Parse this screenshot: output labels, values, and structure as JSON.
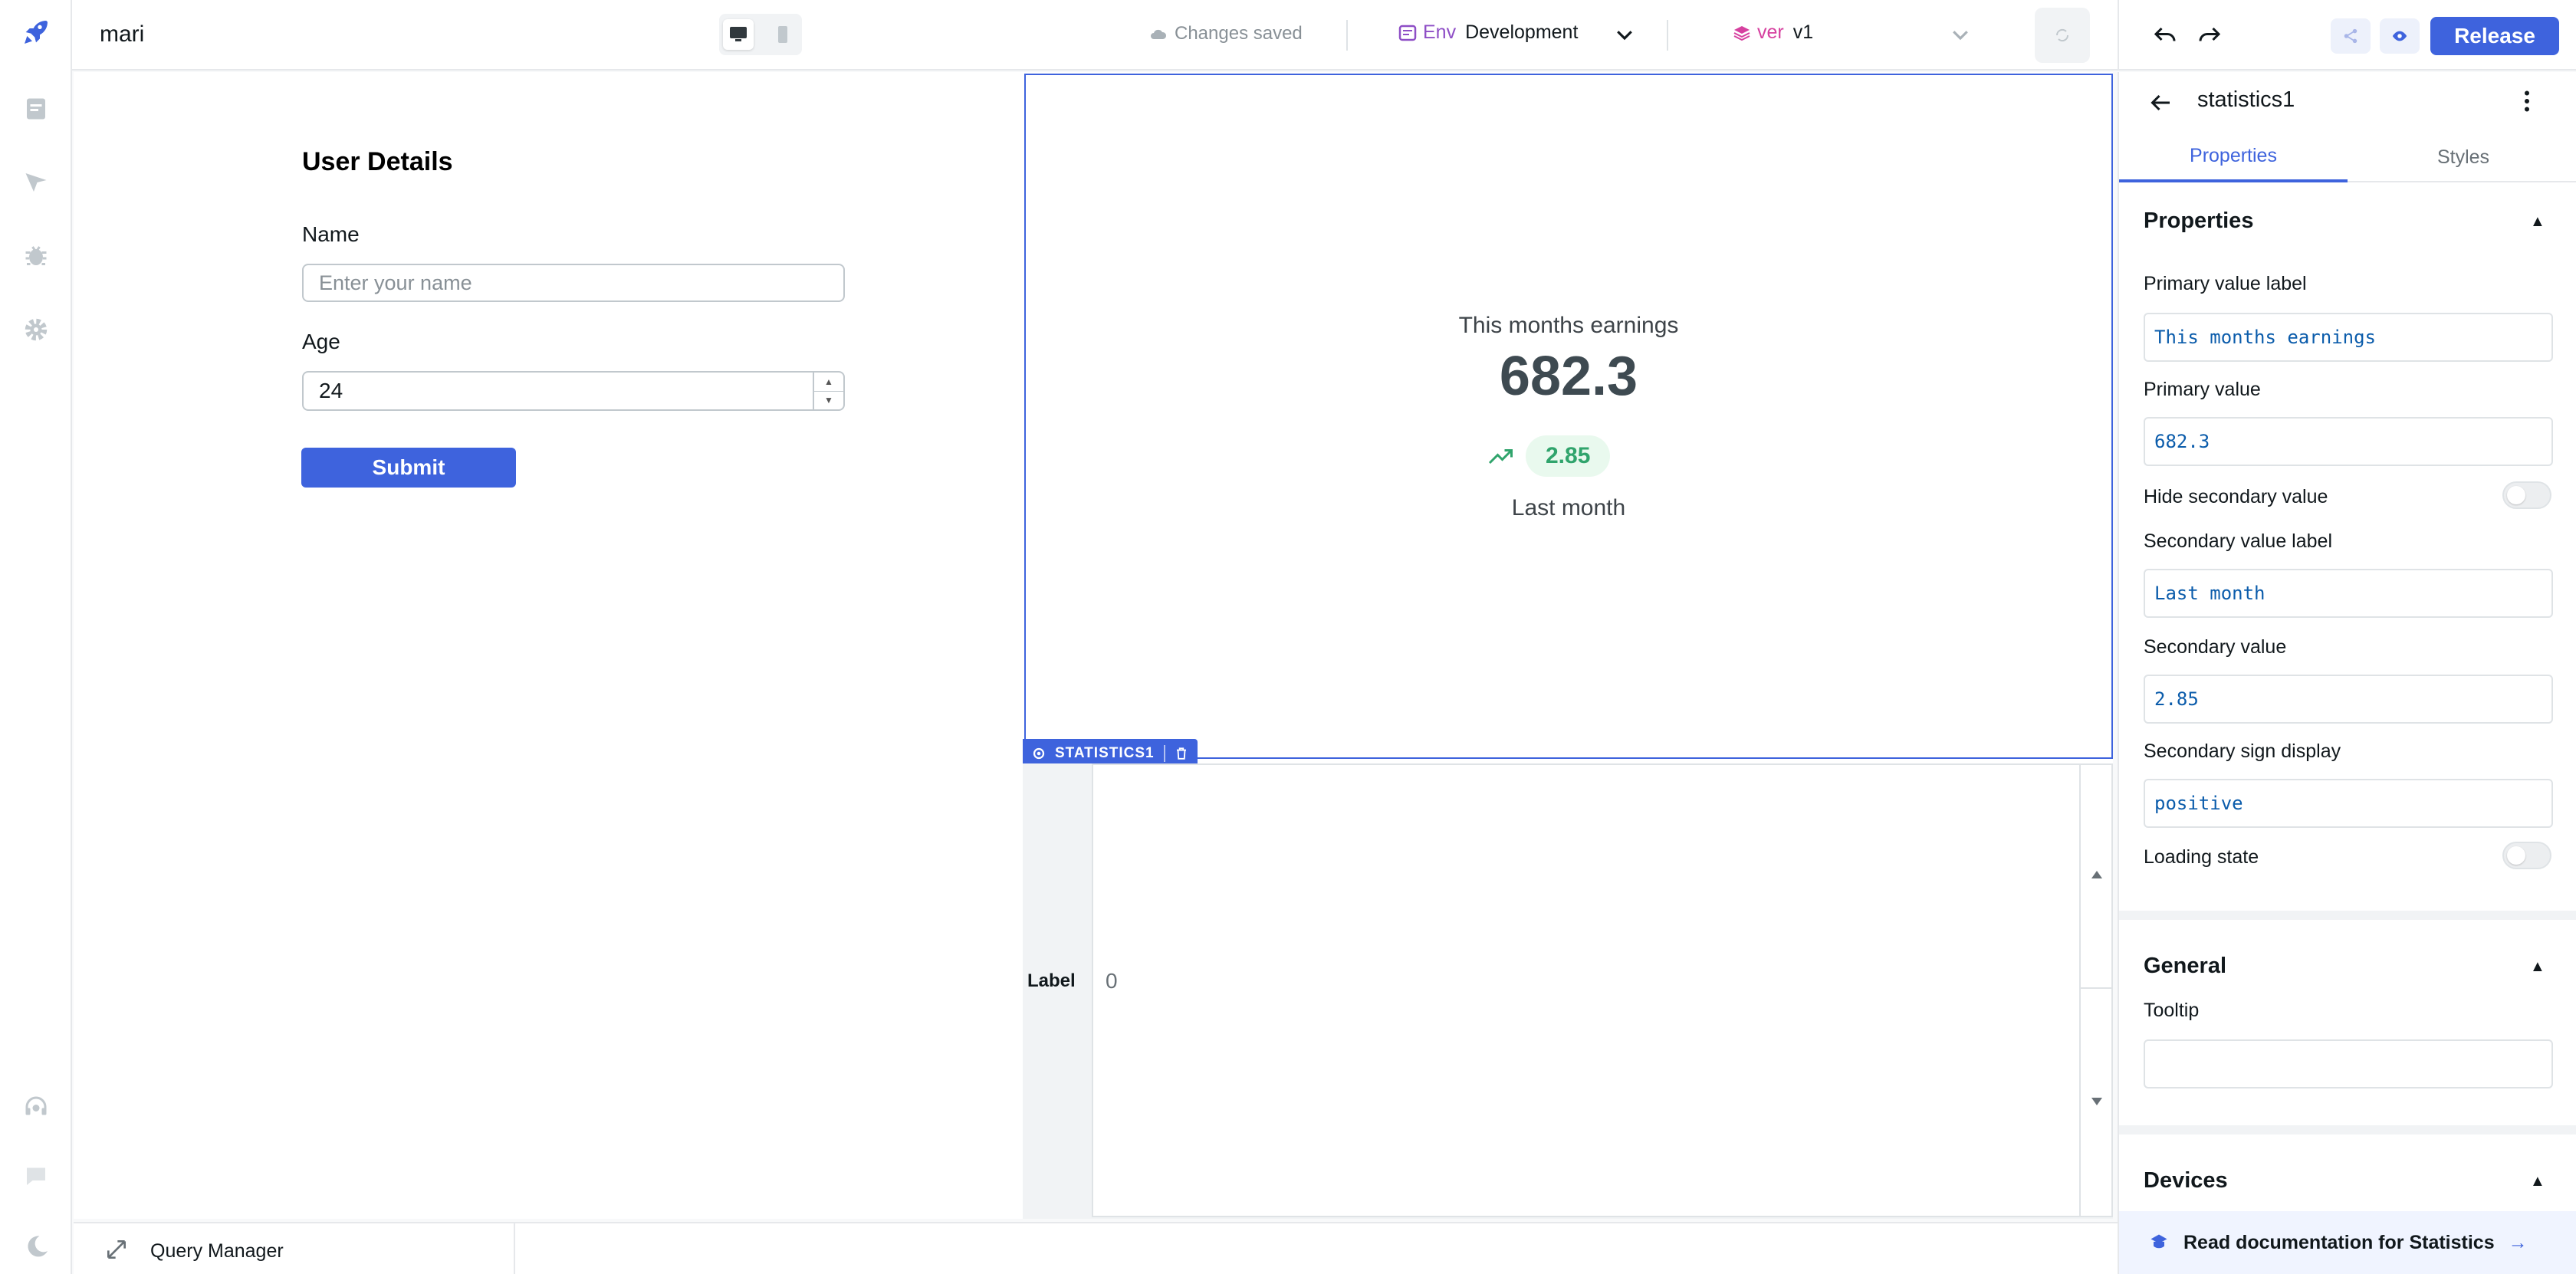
{
  "header": {
    "app_name": "mari",
    "save_status": "Changes saved",
    "env_tag": "Env",
    "env_value": "Development",
    "version_tag": "ver",
    "version_value": "v1",
    "release_label": "Release"
  },
  "canvas": {
    "form": {
      "title": "User Details",
      "name_label": "Name",
      "name_placeholder": "Enter your name",
      "age_label": "Age",
      "age_value": "24",
      "submit_label": "Submit"
    },
    "statistics": {
      "primary_label": "This months earnings",
      "primary_value": "682.3",
      "secondary_value": "2.85",
      "secondary_label": "Last month",
      "widget_tag": "STATISTICS1"
    },
    "bottom_widget": {
      "label": "Label",
      "value": "0"
    }
  },
  "query_manager": {
    "label": "Query Manager"
  },
  "right_panel": {
    "title": "statistics1",
    "tabs": [
      "Properties",
      "Styles"
    ],
    "active_tab": "Properties",
    "sections": {
      "properties": {
        "title": "Properties",
        "primary_value_label_label": "Primary value label",
        "primary_value_label_value": "This months earnings",
        "primary_value_label": "Primary value",
        "primary_value_value": "682.3",
        "hide_secondary_label": "Hide secondary value",
        "secondary_value_label_label": "Secondary value label",
        "secondary_value_label_value": "Last month",
        "secondary_value_label": "Secondary value",
        "secondary_value_value": "2.85",
        "secondary_sign_label": "Secondary sign display",
        "secondary_sign_value": "positive",
        "loading_state_label": "Loading state"
      },
      "general": {
        "title": "General",
        "tooltip_label": "Tooltip",
        "tooltip_value": ""
      },
      "devices": {
        "title": "Devices"
      }
    },
    "docs_link": "Read documentation for Statistics"
  },
  "colors": {
    "accent": "#3e63dd",
    "success": "#30a46c",
    "env": "#8e4ec6",
    "version": "#d6409f"
  }
}
